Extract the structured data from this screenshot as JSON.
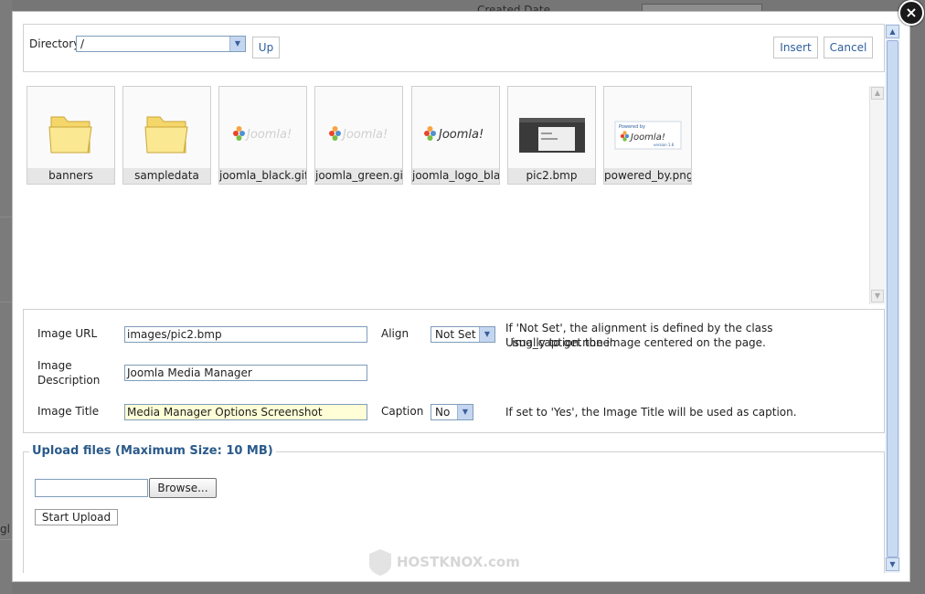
{
  "background": {
    "created_date_label": "Created Date",
    "left_fragment": "gl"
  },
  "modal": {
    "close_label": "×"
  },
  "toolbar": {
    "directory_label": "Directory",
    "directory_value": "/",
    "up_label": "Up",
    "insert_label": "Insert",
    "cancel_label": "Cancel"
  },
  "thumbnails": [
    {
      "name": "banners",
      "type": "folder"
    },
    {
      "name": "sampledata",
      "type": "folder"
    },
    {
      "name": "joomla_black.gif",
      "type": "logo-light"
    },
    {
      "name": "joomla_green.gif",
      "type": "logo-light"
    },
    {
      "name": "joomla_logo_black",
      "type": "logo-dark"
    },
    {
      "name": "pic2.bmp",
      "type": "screenshot"
    },
    {
      "name": "powered_by.png",
      "type": "powered"
    }
  ],
  "thumbnail_art": {
    "joomla_text": "Joomla!",
    "powered_text": "Powered by",
    "version_text": "version 1.6"
  },
  "options": {
    "image_url_label": "Image URL",
    "image_url_value": "images/pic2.bmp",
    "align_label": "Align",
    "align_value": "Not Set",
    "align_note_line1": "If 'Not Set', the alignment is defined by the class '.img_caption.none'.",
    "align_note_line2": "Usually to get the image centered on the page.",
    "image_description_label_line1": "Image",
    "image_description_label_line2": "Description",
    "image_description_value": "Joomla Media Manager",
    "image_title_label": "Image Title",
    "image_title_value": "Media Manager Options Screenshot",
    "caption_label": "Caption",
    "caption_value": "No",
    "caption_note": "If set to 'Yes', the Image Title will be used as caption."
  },
  "upload": {
    "legend": "Upload files (Maximum Size: 10 MB)",
    "browse_label": "Browse...",
    "start_label": "Start Upload"
  },
  "watermark": "HOSTKNOX.com",
  "colors": {
    "accent": "#2f5f9d",
    "legend": "#2a5a8a",
    "focus_bg": "#fffed6"
  }
}
